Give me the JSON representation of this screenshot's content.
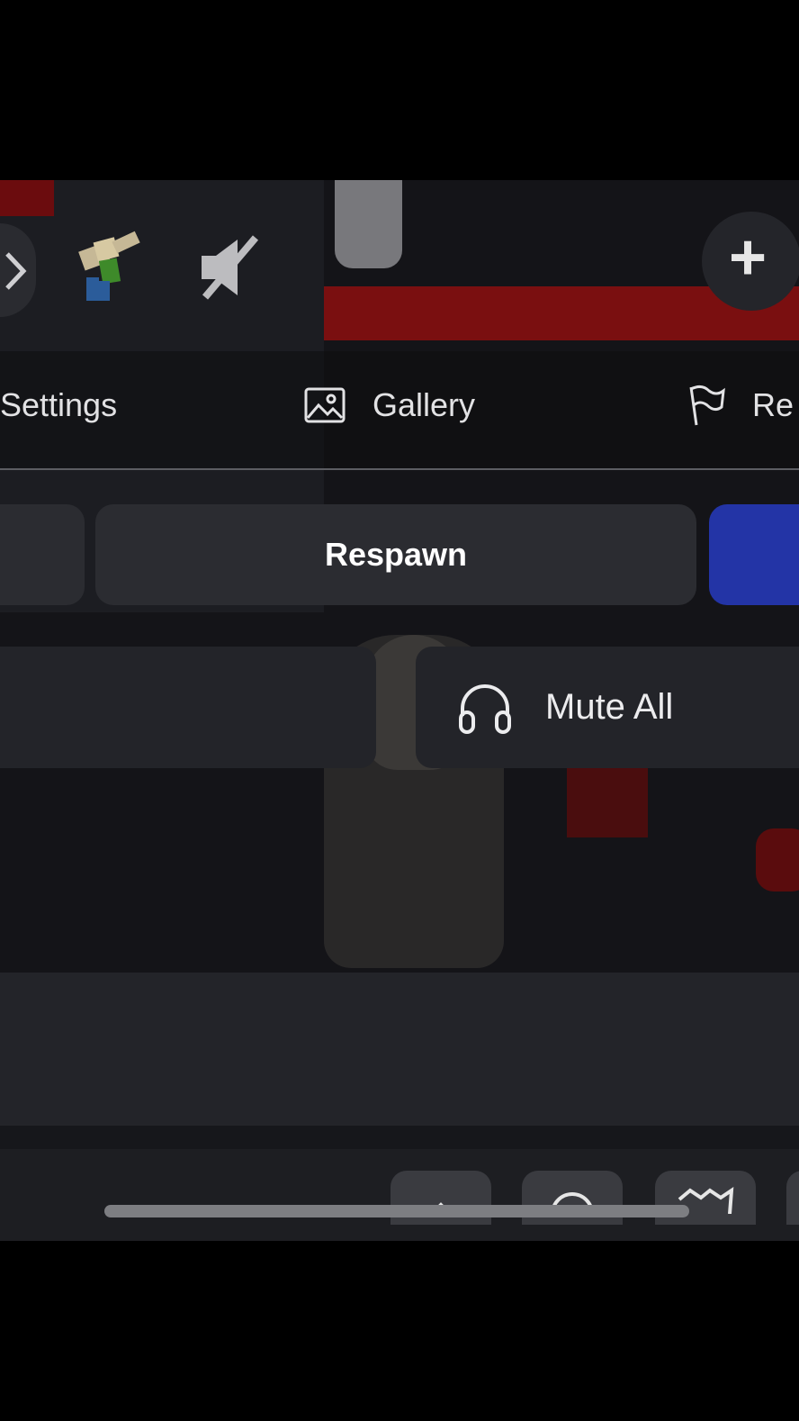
{
  "top_bar": {
    "icons": [
      "settings-gear-icon",
      "avatar-icon",
      "muted-speaker-icon",
      "plus-icon"
    ],
    "plus_label": "+"
  },
  "tabs": [
    {
      "label": "Settings",
      "icon": "gear-icon"
    },
    {
      "label": "Gallery",
      "icon": "image-icon"
    },
    {
      "label": "Re",
      "icon": "flag-icon"
    }
  ],
  "actions": {
    "respawn_label": "Respawn"
  },
  "voice": {
    "mute_all_label": "Mute All",
    "icon": "headphones-icon"
  },
  "bottom_bar": {
    "icons": [
      "arrow-icon",
      "chat-icon",
      "crown-icon"
    ]
  },
  "colors": {
    "panel": "#232429",
    "button": "#2b2c31",
    "primary_blue": "#2334a6",
    "text": "#ffffff"
  }
}
